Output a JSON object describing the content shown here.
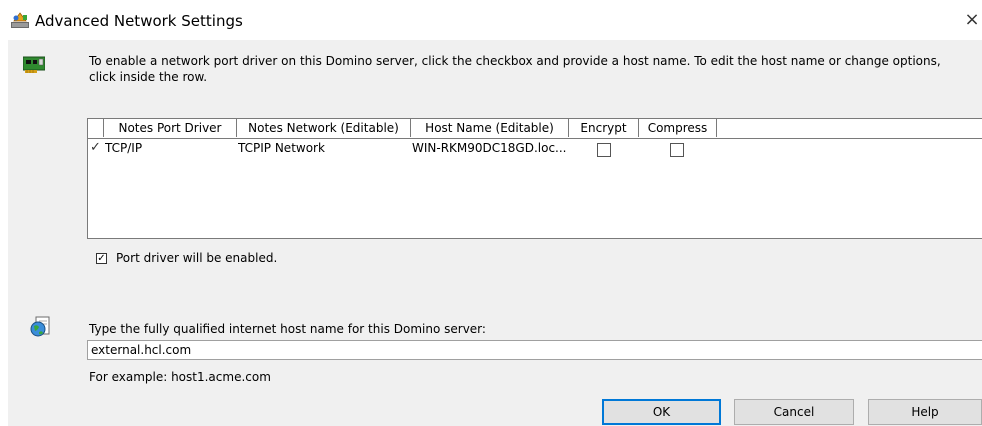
{
  "window": {
    "title": "Advanced Network Settings",
    "close_glyph": "×",
    "icons": {
      "app": "network-settings-icon",
      "close": "close-icon"
    }
  },
  "intro": {
    "text": "To enable a network port driver on this Domino server, click the checkbox and provide a host name. To edit the host name or change options, click inside the row.",
    "icon": "network-card-icon"
  },
  "grid": {
    "columns": [
      "Notes Port Driver",
      "Notes Network (Editable)",
      "Host Name (Editable)",
      "Encrypt",
      "Compress"
    ],
    "rows": [
      {
        "enabled_mark": "✓",
        "port_driver": "TCP/IP",
        "network": "TCPIP Network",
        "host_name": "WIN-RKM90DC18GD.loc...",
        "encrypt": false,
        "compress": false
      }
    ]
  },
  "enable_checkbox": {
    "checked": true,
    "label": "Port driver will be enabled."
  },
  "host": {
    "prompt": "Type the fully qualified internet host name for this Domino server:",
    "value": "external.hcl.com",
    "example": "For example: host1.acme.com",
    "icon": "globe-icon"
  },
  "buttons": {
    "ok": "OK",
    "cancel": "Cancel",
    "help": "Help"
  },
  "colors": {
    "dialog_bg": "#f0f0f0",
    "default_button_border": "#0078d7"
  }
}
